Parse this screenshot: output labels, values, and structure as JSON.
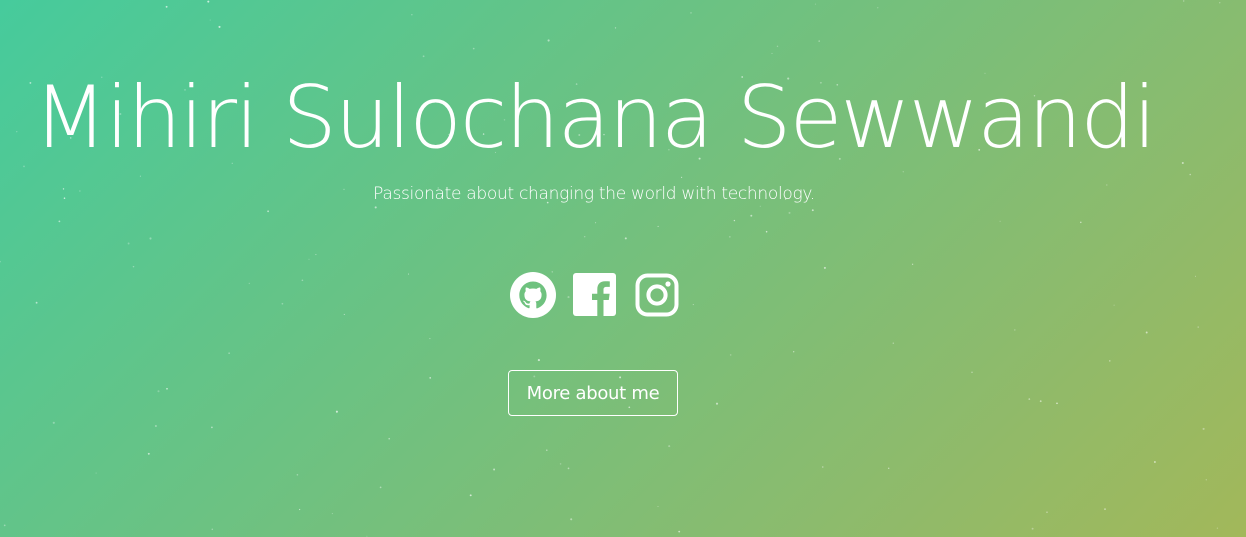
{
  "hero": {
    "title": "Mihiri Sulochana Sewwandi",
    "subtitle": "Passionate about changing the world with technology."
  },
  "social": [
    {
      "icon": "github-icon",
      "label": "GitHub"
    },
    {
      "icon": "facebook-icon",
      "label": "Facebook"
    },
    {
      "icon": "instagram-icon",
      "label": "Instagram"
    }
  ],
  "cta": {
    "label": "More about me"
  },
  "colors": {
    "gradient_start": "#46cb9c",
    "gradient_end": "#a2b85a",
    "text": "#ffffff"
  }
}
